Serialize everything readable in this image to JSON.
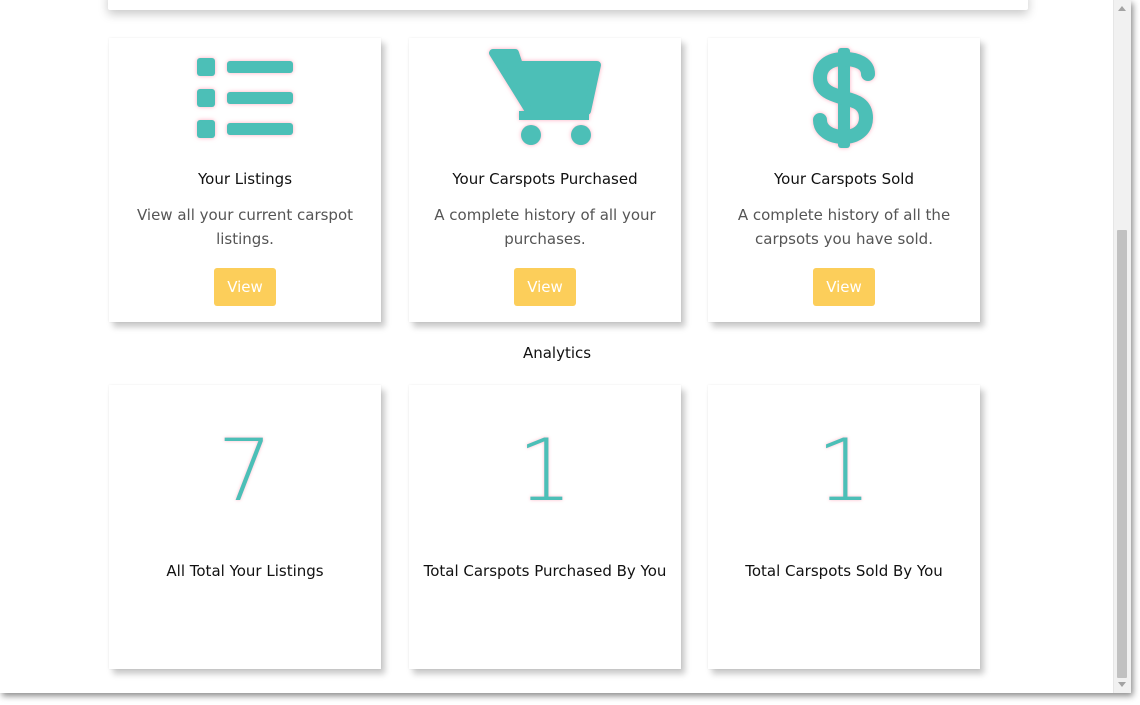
{
  "features": [
    {
      "icon": "list-icon",
      "title": "Your Listings",
      "description": "View all your current carspot listings.",
      "button_label": "View"
    },
    {
      "icon": "shopping-cart-icon",
      "title": "Your Carspots Purchased",
      "description": "A complete history of all your purchases.",
      "button_label": "View"
    },
    {
      "icon": "dollar-icon",
      "title": "Your Carspots Sold",
      "description": "A complete history of all the carpsots you have sold.",
      "button_label": "View"
    }
  ],
  "analytics": {
    "heading": "Analytics",
    "stats": [
      {
        "value": "7",
        "label": "All Total Your Listings"
      },
      {
        "value": "1",
        "label": "Total Carspots Purchased By You"
      },
      {
        "value": "1",
        "label": "Total Carspots Sold By You"
      }
    ]
  },
  "colors": {
    "accent": "#4cbfb7",
    "button": "#fcce5a",
    "glow": "#ff698c"
  }
}
